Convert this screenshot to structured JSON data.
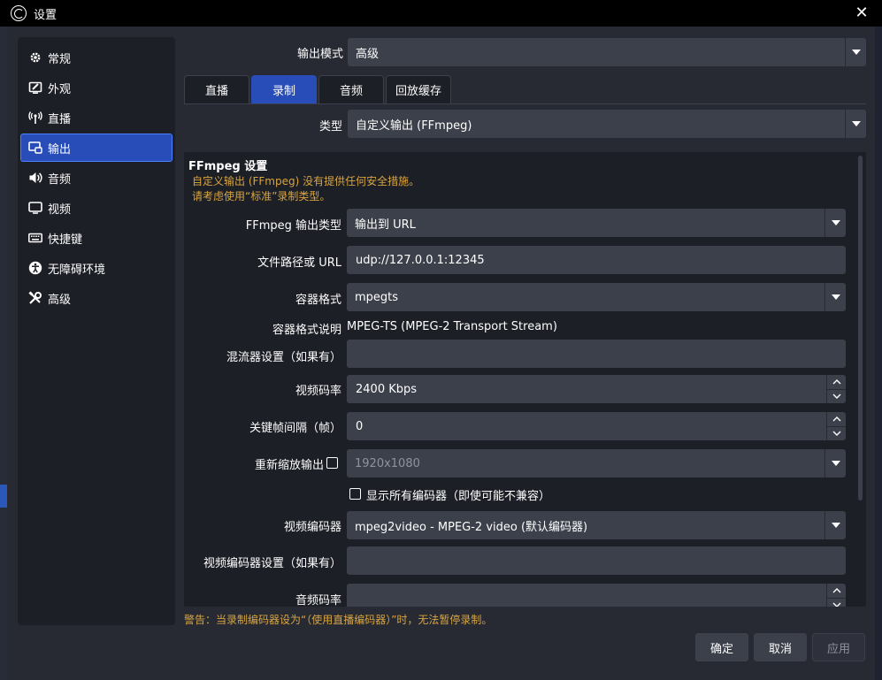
{
  "window": {
    "title": "设置"
  },
  "sidebar": {
    "items": [
      {
        "label": "常规",
        "icon": "gear-icon",
        "active": false
      },
      {
        "label": "外观",
        "icon": "appearance-icon",
        "active": false
      },
      {
        "label": "直播",
        "icon": "broadcast-icon",
        "active": false
      },
      {
        "label": "输出",
        "icon": "output-icon",
        "active": true
      },
      {
        "label": "音频",
        "icon": "speaker-icon",
        "active": false
      },
      {
        "label": "视频",
        "icon": "monitor-icon",
        "active": false
      },
      {
        "label": "快捷键",
        "icon": "keyboard-icon",
        "active": false
      },
      {
        "label": "无障碍环境",
        "icon": "accessibility-icon",
        "active": false
      },
      {
        "label": "高级",
        "icon": "tools-icon",
        "active": false
      }
    ]
  },
  "output_mode": {
    "label": "输出模式",
    "value": "高级"
  },
  "tabs": [
    {
      "label": "直播",
      "active": false
    },
    {
      "label": "录制",
      "active": true
    },
    {
      "label": "音频",
      "active": false
    },
    {
      "label": "回放缓存",
      "active": false
    }
  ],
  "type": {
    "label": "类型",
    "value": "自定义输出 (FFmpeg)"
  },
  "ffmpeg": {
    "title": "FFmpeg 设置",
    "warning_line1": "自定义输出 (FFmpeg) 没有提供任何安全措施。",
    "warning_line2": "请考虑使用“标准”录制类型。",
    "output_type": {
      "label": "FFmpeg 输出类型",
      "value": "输出到 URL"
    },
    "path": {
      "label": "文件路径或 URL",
      "value": "udp://127.0.0.1:12345"
    },
    "container": {
      "label": "容器格式",
      "value": "mpegts"
    },
    "container_desc": {
      "label": "容器格式说明",
      "value": "MPEG-TS (MPEG-2 Transport Stream)"
    },
    "muxer": {
      "label": "混流器设置（如果有）",
      "value": ""
    },
    "video_bitrate": {
      "label": "视频码率",
      "value": "2400 Kbps"
    },
    "keyframe": {
      "label": "关键帧间隔（帧）",
      "value": "0"
    },
    "rescale": {
      "label": "重新缩放输出",
      "value": "1920x1080",
      "checked": false
    },
    "show_all": {
      "label": "显示所有编码器（即使可能不兼容）",
      "checked": false
    },
    "video_encoder": {
      "label": "视频编码器",
      "value": "mpeg2video - MPEG-2 video (默认编码器)"
    },
    "video_encoder_settings": {
      "label": "视频编码器设置（如果有）",
      "value": ""
    },
    "audio_bitrate_partial": {
      "label": "音频码率"
    }
  },
  "footer": {
    "warning": "警告：当录制编码器设为“（使用直播编码器）”时，无法暂停录制。",
    "ok": "确定",
    "cancel": "取消",
    "apply": "应用"
  },
  "colors": {
    "accent": "#284cb8",
    "warning": "#d8a43f",
    "panel": "#1d1f26",
    "background": "#272a33"
  }
}
